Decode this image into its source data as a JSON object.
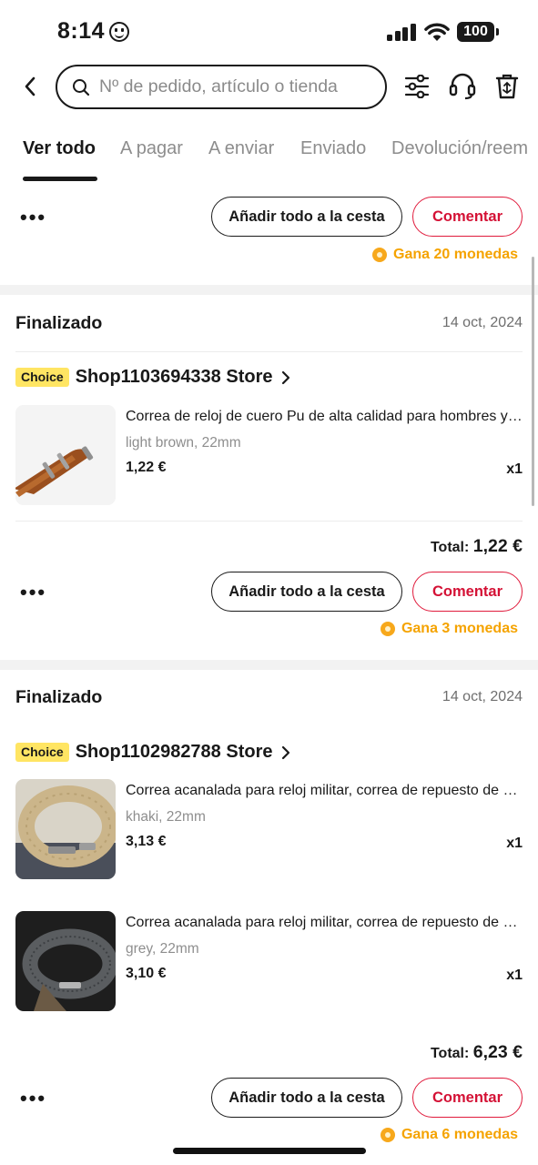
{
  "status_bar": {
    "time": "8:14",
    "battery": "100"
  },
  "header": {
    "search_placeholder": "Nº de pedido, artículo o tienda"
  },
  "tabs": [
    "Ver todo",
    "A pagar",
    "A enviar",
    "Enviado",
    "Devolución/reem"
  ],
  "top_partial": {
    "more": "•••",
    "add_all_label": "Añadir todo a la cesta",
    "comment_label": "Comentar",
    "coins": "Gana 20 monedas"
  },
  "orders": [
    {
      "status": "Finalizado",
      "date": "14 oct, 2024",
      "badge": "Choice",
      "store": "Shop1103694338 Store",
      "items": [
        {
          "title": "Correa de reloj de cuero Pu de alta calidad para hombres y mujeres",
          "variant": "light brown, 22mm",
          "price": "1,22 €",
          "qty": "x1"
        }
      ],
      "total_label": "Total:",
      "total_value": "1,22 €",
      "more": "•••",
      "add_all_label": "Añadir todo a la cesta",
      "comment_label": "Comentar",
      "coins": "Gana 3 monedas"
    },
    {
      "status": "Finalizado",
      "date": "14 oct, 2024",
      "badge": "Choice",
      "store": "Shop1102982788 Store",
      "items": [
        {
          "title": "Correa acanalada para reloj militar, correa de repuesto de nailon",
          "variant": "khaki, 22mm",
          "price": "3,13 €",
          "qty": "x1"
        },
        {
          "title": "Correa acanalada para reloj militar, correa de repuesto de nailon",
          "variant": "grey, 22mm",
          "price": "3,10 €",
          "qty": "x1"
        }
      ],
      "total_label": "Total:",
      "total_value": "6,23 €",
      "more": "•••",
      "add_all_label": "Añadir todo a la cesta",
      "comment_label": "Comentar",
      "coins": "Gana 6 monedas"
    }
  ],
  "icons": [
    "back-arrow-icon",
    "search-icon",
    "filter-sliders-icon",
    "headset-icon",
    "recycle-bin-icon",
    "chevron-right-icon",
    "coin-icon"
  ],
  "colors": {
    "accent_red": "#d41135",
    "coin_orange": "#f5a300",
    "choice_yellow": "#ffe563",
    "text": "#191919",
    "muted": "#8e8e8e"
  }
}
